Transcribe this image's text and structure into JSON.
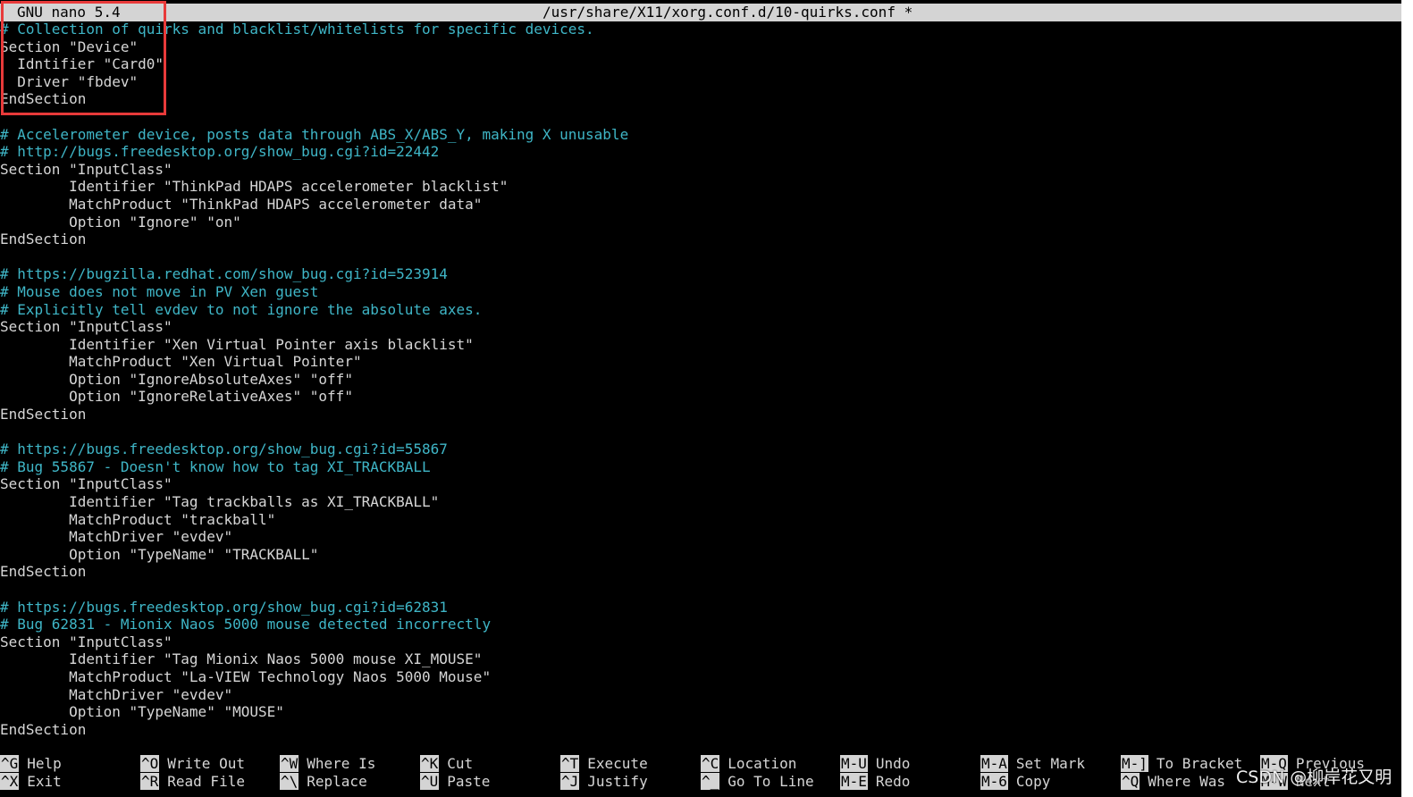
{
  "titlebar": {
    "app": "GNU nano 5.4",
    "path": "/usr/share/X11/xorg.conf.d/10-quirks.conf *"
  },
  "lines": [
    {
      "type": "comment",
      "text": "# Collection of quirks and blacklist/whitelists for specific devices."
    },
    {
      "type": "text",
      "text": "Section \"Device\""
    },
    {
      "type": "text",
      "text": "  Idntifier \"Card0\""
    },
    {
      "type": "text",
      "text": "  Driver \"fbdev\""
    },
    {
      "type": "text",
      "text": "EndSection"
    },
    {
      "type": "text",
      "text": ""
    },
    {
      "type": "comment",
      "text": "# Accelerometer device, posts data through ABS_X/ABS_Y, making X unusable"
    },
    {
      "type": "comment",
      "text": "# http://bugs.freedesktop.org/show_bug.cgi?id=22442"
    },
    {
      "type": "text",
      "text": "Section \"InputClass\""
    },
    {
      "type": "text",
      "text": "        Identifier \"ThinkPad HDAPS accelerometer blacklist\""
    },
    {
      "type": "text",
      "text": "        MatchProduct \"ThinkPad HDAPS accelerometer data\""
    },
    {
      "type": "text",
      "text": "        Option \"Ignore\" \"on\""
    },
    {
      "type": "text",
      "text": "EndSection"
    },
    {
      "type": "text",
      "text": ""
    },
    {
      "type": "comment",
      "text": "# https://bugzilla.redhat.com/show_bug.cgi?id=523914"
    },
    {
      "type": "comment",
      "text": "# Mouse does not move in PV Xen guest"
    },
    {
      "type": "comment",
      "text": "# Explicitly tell evdev to not ignore the absolute axes."
    },
    {
      "type": "text",
      "text": "Section \"InputClass\""
    },
    {
      "type": "text",
      "text": "        Identifier \"Xen Virtual Pointer axis blacklist\""
    },
    {
      "type": "text",
      "text": "        MatchProduct \"Xen Virtual Pointer\""
    },
    {
      "type": "text",
      "text": "        Option \"IgnoreAbsoluteAxes\" \"off\""
    },
    {
      "type": "text",
      "text": "        Option \"IgnoreRelativeAxes\" \"off\""
    },
    {
      "type": "text",
      "text": "EndSection"
    },
    {
      "type": "text",
      "text": ""
    },
    {
      "type": "comment",
      "text": "# https://bugs.freedesktop.org/show_bug.cgi?id=55867"
    },
    {
      "type": "comment",
      "text": "# Bug 55867 - Doesn't know how to tag XI_TRACKBALL"
    },
    {
      "type": "text",
      "text": "Section \"InputClass\""
    },
    {
      "type": "text",
      "text": "        Identifier \"Tag trackballs as XI_TRACKBALL\""
    },
    {
      "type": "text",
      "text": "        MatchProduct \"trackball\""
    },
    {
      "type": "text",
      "text": "        MatchDriver \"evdev\""
    },
    {
      "type": "text",
      "text": "        Option \"TypeName\" \"TRACKBALL\""
    },
    {
      "type": "text",
      "text": "EndSection"
    },
    {
      "type": "text",
      "text": ""
    },
    {
      "type": "comment",
      "text": "# https://bugs.freedesktop.org/show_bug.cgi?id=62831"
    },
    {
      "type": "comment",
      "text": "# Bug 62831 - Mionix Naos 5000 mouse detected incorrectly"
    },
    {
      "type": "text",
      "text": "Section \"InputClass\""
    },
    {
      "type": "text",
      "text": "        Identifier \"Tag Mionix Naos 5000 mouse XI_MOUSE\""
    },
    {
      "type": "text",
      "text": "        MatchProduct \"La-VIEW Technology Naos 5000 Mouse\""
    },
    {
      "type": "text",
      "text": "        MatchDriver \"evdev\""
    },
    {
      "type": "text",
      "text": "        Option \"TypeName\" \"MOUSE\""
    },
    {
      "type": "text",
      "text": "EndSection"
    }
  ],
  "shortcuts": [
    [
      {
        "key": "^G",
        "label": "Help"
      },
      {
        "key": "^X",
        "label": "Exit"
      }
    ],
    [
      {
        "key": "^O",
        "label": "Write Out"
      },
      {
        "key": "^R",
        "label": "Read File"
      }
    ],
    [
      {
        "key": "^W",
        "label": "Where Is"
      },
      {
        "key": "^\\",
        "label": "Replace"
      }
    ],
    [
      {
        "key": "^K",
        "label": "Cut"
      },
      {
        "key": "^U",
        "label": "Paste"
      }
    ],
    [
      {
        "key": "^T",
        "label": "Execute"
      },
      {
        "key": "^J",
        "label": "Justify"
      }
    ],
    [
      {
        "key": "^C",
        "label": "Location"
      },
      {
        "key": "^_",
        "label": "Go To Line"
      }
    ],
    [
      {
        "key": "M-U",
        "label": "Undo"
      },
      {
        "key": "M-E",
        "label": "Redo"
      }
    ],
    [
      {
        "key": "M-A",
        "label": "Set Mark"
      },
      {
        "key": "M-6",
        "label": "Copy"
      }
    ],
    [
      {
        "key": "M-]",
        "label": "To Bracket"
      },
      {
        "key": "^Q",
        "label": "Where Was"
      }
    ],
    [
      {
        "key": "M-Q",
        "label": "Previous"
      },
      {
        "key": "M-W",
        "label": "Next"
      }
    ]
  ],
  "watermark": "CSDN @柳岸花又明",
  "colors": {
    "comment": "#3fb6c7",
    "text": "#d6d6d6",
    "bar": "#d4d4d4",
    "highlight_box": "#e83a3a"
  }
}
